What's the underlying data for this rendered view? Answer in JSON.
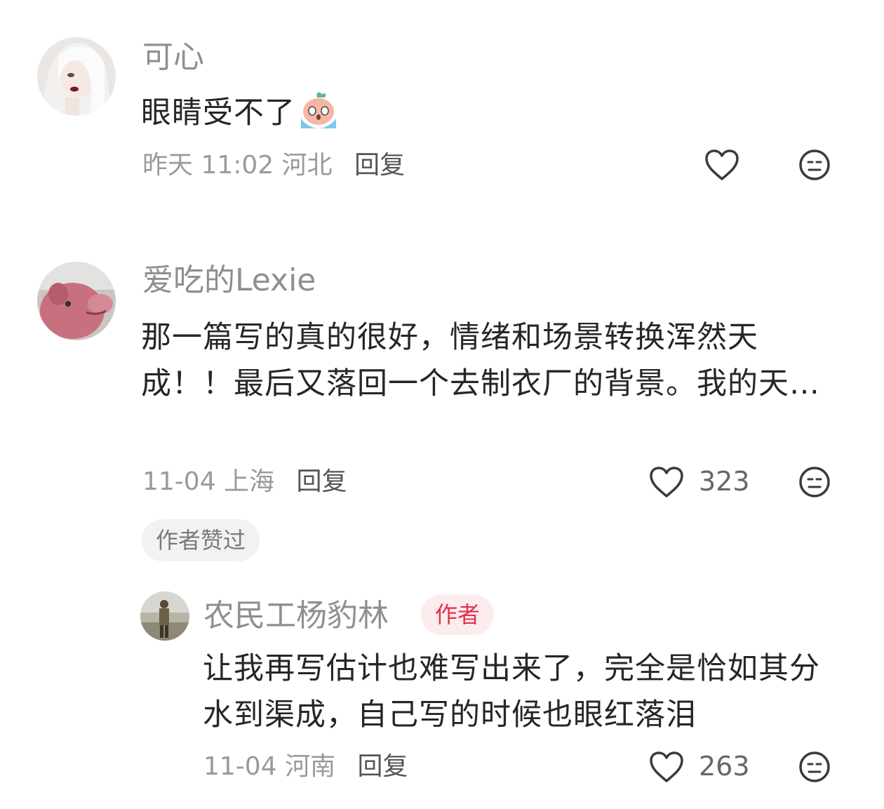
{
  "comments": [
    {
      "username": "可心",
      "text": "眼睛受不了",
      "emoji": "crying-peach-emoji",
      "time": "昨天 11:02",
      "location": "河北",
      "reply_label": "回复",
      "likes": "",
      "icons": [
        "heart-outline-icon",
        "neutral-face-icon"
      ]
    },
    {
      "username": "爱吃的Lexie",
      "text": "那一篇写的真的很好，情绪和场景转换浑然天成！！最后又落回一个去制衣厂的背景。我的天…",
      "time": "11-04",
      "location": "上海",
      "reply_label": "回复",
      "likes": "323",
      "badge": "作者赞过",
      "icons": [
        "heart-outline-icon",
        "neutral-face-icon"
      ]
    }
  ],
  "reply": {
    "username": "农民工杨豹林",
    "author_tag": "作者",
    "text": "让我再写估计也难写出来了，完全是恰如其分水到渠成，自己写的时候也眼红落泪",
    "time": "11-04",
    "location": "河南",
    "reply_label": "回复",
    "likes": "263",
    "icons": [
      "heart-outline-icon",
      "neutral-face-icon"
    ]
  },
  "colors": {
    "author_tag_text": "#e0314b",
    "author_tag_bg": "#fdecee",
    "username": "#8f8f8f",
    "body_text": "#262626"
  }
}
